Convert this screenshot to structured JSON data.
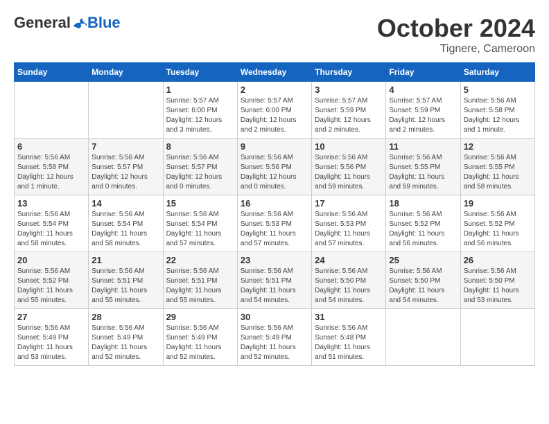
{
  "header": {
    "logo": {
      "general": "General",
      "blue": "Blue"
    },
    "title": "October 2024",
    "subtitle": "Tignere, Cameroon"
  },
  "weekdays": [
    "Sunday",
    "Monday",
    "Tuesday",
    "Wednesday",
    "Thursday",
    "Friday",
    "Saturday"
  ],
  "weeks": [
    [
      null,
      null,
      {
        "day": 1,
        "sunrise": "5:57 AM",
        "sunset": "6:00 PM",
        "daylight": "12 hours and 3 minutes."
      },
      {
        "day": 2,
        "sunrise": "5:57 AM",
        "sunset": "6:00 PM",
        "daylight": "12 hours and 2 minutes."
      },
      {
        "day": 3,
        "sunrise": "5:57 AM",
        "sunset": "5:59 PM",
        "daylight": "12 hours and 2 minutes."
      },
      {
        "day": 4,
        "sunrise": "5:57 AM",
        "sunset": "5:59 PM",
        "daylight": "12 hours and 2 minutes."
      },
      {
        "day": 5,
        "sunrise": "5:56 AM",
        "sunset": "5:58 PM",
        "daylight": "12 hours and 1 minute."
      }
    ],
    [
      {
        "day": 6,
        "sunrise": "5:56 AM",
        "sunset": "5:58 PM",
        "daylight": "12 hours and 1 minute."
      },
      {
        "day": 7,
        "sunrise": "5:56 AM",
        "sunset": "5:57 PM",
        "daylight": "12 hours and 0 minutes."
      },
      {
        "day": 8,
        "sunrise": "5:56 AM",
        "sunset": "5:57 PM",
        "daylight": "12 hours and 0 minutes."
      },
      {
        "day": 9,
        "sunrise": "5:56 AM",
        "sunset": "5:56 PM",
        "daylight": "12 hours and 0 minutes."
      },
      {
        "day": 10,
        "sunrise": "5:56 AM",
        "sunset": "5:56 PM",
        "daylight": "11 hours and 59 minutes."
      },
      {
        "day": 11,
        "sunrise": "5:56 AM",
        "sunset": "5:55 PM",
        "daylight": "11 hours and 59 minutes."
      },
      {
        "day": 12,
        "sunrise": "5:56 AM",
        "sunset": "5:55 PM",
        "daylight": "11 hours and 58 minutes."
      }
    ],
    [
      {
        "day": 13,
        "sunrise": "5:56 AM",
        "sunset": "5:54 PM",
        "daylight": "11 hours and 58 minutes."
      },
      {
        "day": 14,
        "sunrise": "5:56 AM",
        "sunset": "5:54 PM",
        "daylight": "11 hours and 58 minutes."
      },
      {
        "day": 15,
        "sunrise": "5:56 AM",
        "sunset": "5:54 PM",
        "daylight": "11 hours and 57 minutes."
      },
      {
        "day": 16,
        "sunrise": "5:56 AM",
        "sunset": "5:53 PM",
        "daylight": "11 hours and 57 minutes."
      },
      {
        "day": 17,
        "sunrise": "5:56 AM",
        "sunset": "5:53 PM",
        "daylight": "11 hours and 57 minutes."
      },
      {
        "day": 18,
        "sunrise": "5:56 AM",
        "sunset": "5:52 PM",
        "daylight": "11 hours and 56 minutes."
      },
      {
        "day": 19,
        "sunrise": "5:56 AM",
        "sunset": "5:52 PM",
        "daylight": "11 hours and 56 minutes."
      }
    ],
    [
      {
        "day": 20,
        "sunrise": "5:56 AM",
        "sunset": "5:52 PM",
        "daylight": "11 hours and 55 minutes."
      },
      {
        "day": 21,
        "sunrise": "5:56 AM",
        "sunset": "5:51 PM",
        "daylight": "11 hours and 55 minutes."
      },
      {
        "day": 22,
        "sunrise": "5:56 AM",
        "sunset": "5:51 PM",
        "daylight": "11 hours and 55 minutes."
      },
      {
        "day": 23,
        "sunrise": "5:56 AM",
        "sunset": "5:51 PM",
        "daylight": "11 hours and 54 minutes."
      },
      {
        "day": 24,
        "sunrise": "5:56 AM",
        "sunset": "5:50 PM",
        "daylight": "11 hours and 54 minutes."
      },
      {
        "day": 25,
        "sunrise": "5:56 AM",
        "sunset": "5:50 PM",
        "daylight": "11 hours and 54 minutes."
      },
      {
        "day": 26,
        "sunrise": "5:56 AM",
        "sunset": "5:50 PM",
        "daylight": "11 hours and 53 minutes."
      }
    ],
    [
      {
        "day": 27,
        "sunrise": "5:56 AM",
        "sunset": "5:49 PM",
        "daylight": "11 hours and 53 minutes."
      },
      {
        "day": 28,
        "sunrise": "5:56 AM",
        "sunset": "5:49 PM",
        "daylight": "11 hours and 52 minutes."
      },
      {
        "day": 29,
        "sunrise": "5:56 AM",
        "sunset": "5:49 PM",
        "daylight": "11 hours and 52 minutes."
      },
      {
        "day": 30,
        "sunrise": "5:56 AM",
        "sunset": "5:49 PM",
        "daylight": "11 hours and 52 minutes."
      },
      {
        "day": 31,
        "sunrise": "5:56 AM",
        "sunset": "5:48 PM",
        "daylight": "11 hours and 51 minutes."
      },
      null,
      null
    ]
  ]
}
